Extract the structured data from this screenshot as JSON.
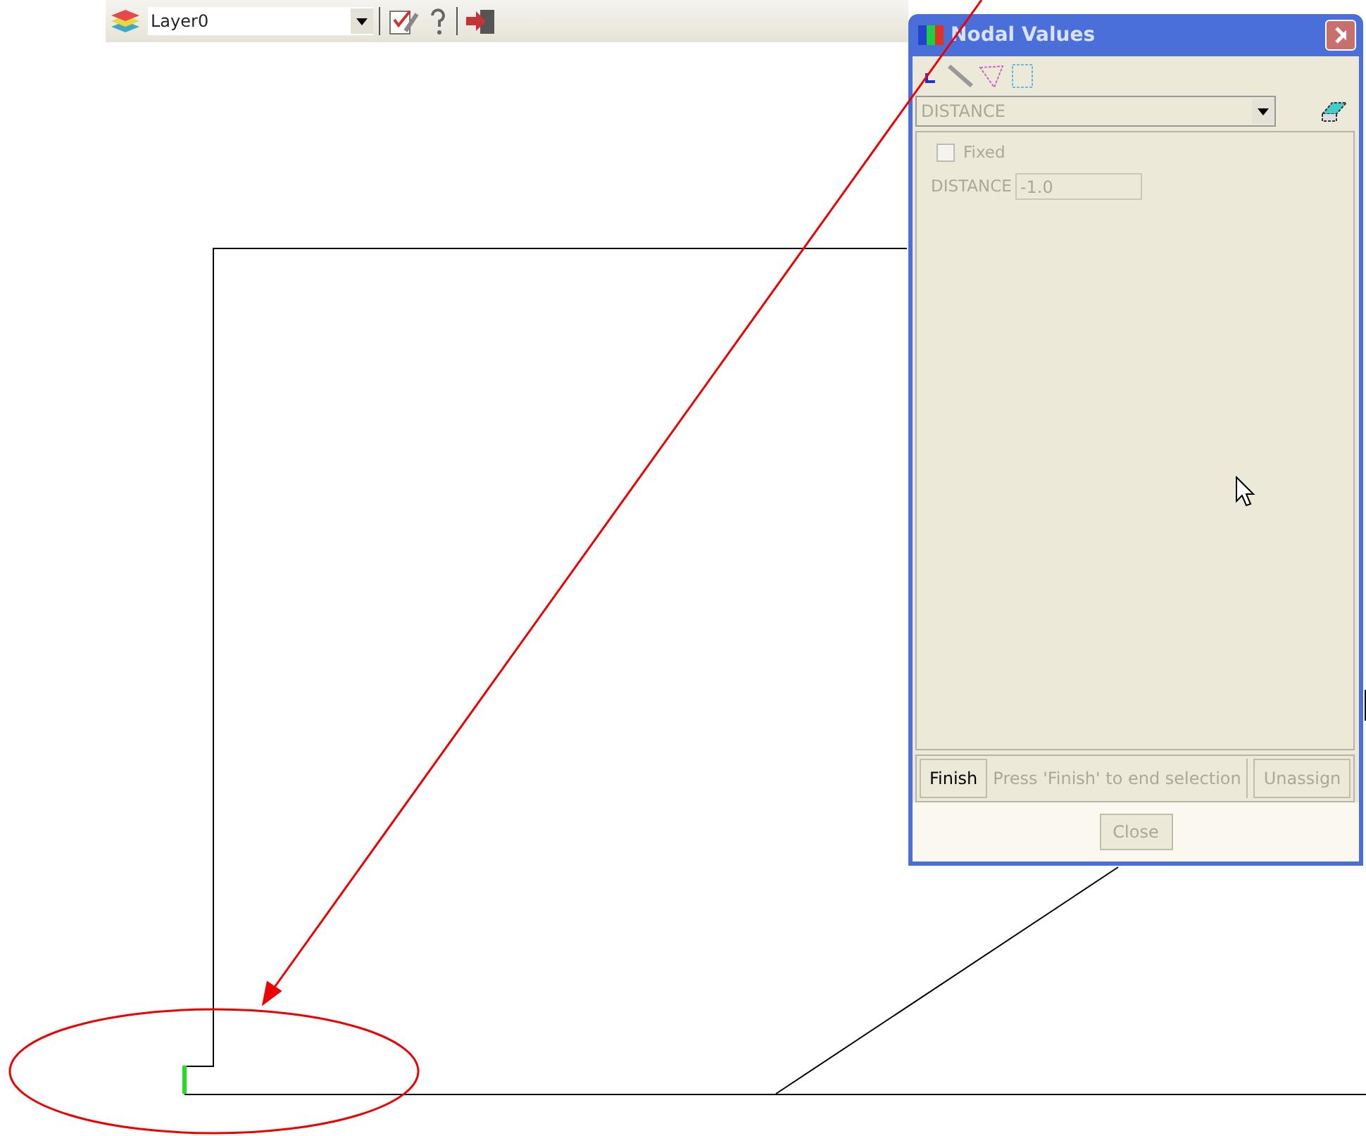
{
  "toolbar": {
    "layer": "Layer0"
  },
  "dialog": {
    "title": "Nodal Values",
    "variable": {
      "value": "DISTANCE",
      "disabled": true
    },
    "fixed": {
      "label": "Fixed",
      "checked": false,
      "disabled": true
    },
    "field": {
      "label": "DISTANCE",
      "value": "-1.0",
      "disabled": true
    },
    "finish": {
      "label": "Finish",
      "disabled": false
    },
    "status": "Press 'Finish' to end selection",
    "unassign": {
      "label": "Unassign",
      "disabled": true
    },
    "close": {
      "label": "Close",
      "disabled": true
    }
  }
}
